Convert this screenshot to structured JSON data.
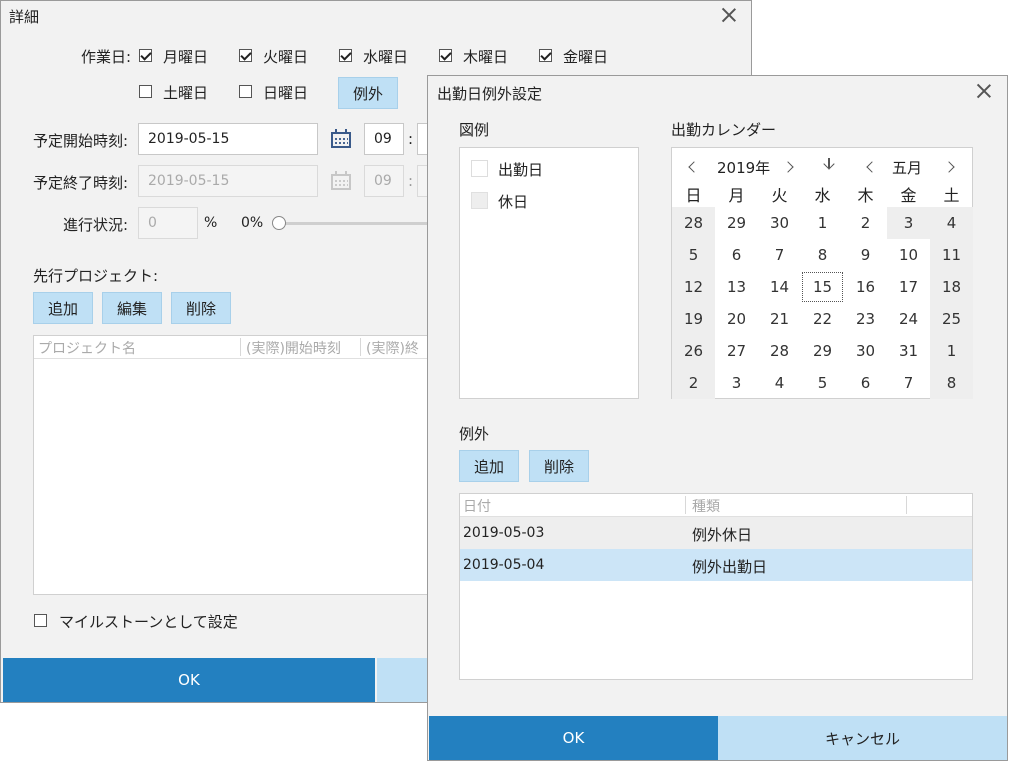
{
  "detail": {
    "title": "詳細",
    "workdays_label": "作業日:",
    "days": [
      {
        "label": "月曜日",
        "checked": true
      },
      {
        "label": "火曜日",
        "checked": true
      },
      {
        "label": "水曜日",
        "checked": true
      },
      {
        "label": "木曜日",
        "checked": true
      },
      {
        "label": "金曜日",
        "checked": true
      },
      {
        "label": "土曜日",
        "checked": false
      },
      {
        "label": "日曜日",
        "checked": false
      }
    ],
    "exception_button": "例外",
    "start_label": "予定開始時刻:",
    "start_date": "2019-05-15",
    "start_hour": "09",
    "end_label": "予定終了時刻:",
    "end_date": "2019-05-15",
    "end_hour": "09",
    "progress_label": "進行状況:",
    "progress_value": "0",
    "progress_unit": "%",
    "progress_pct_text": "0%",
    "progress_fraction": 0,
    "predecessor_label": "先行プロジェクト:",
    "add": "追加",
    "edit": "編集",
    "delete": "削除",
    "columns": [
      "プロジェクト名",
      "(実際)開始時刻",
      "(実際)終"
    ],
    "milestone_label": "マイルストーンとして設定",
    "ok": "OK",
    "colon": ":"
  },
  "exception_dialog": {
    "title": "出勤日例外設定",
    "legend_title": "図例",
    "legend": [
      {
        "label": "出勤日",
        "color": "#ffffff"
      },
      {
        "label": "休日",
        "color": "#eeeeee"
      }
    ],
    "calendar_title": "出勤カレンダー",
    "year": "2019年",
    "month": "五月",
    "dow": [
      "日",
      "月",
      "火",
      "水",
      "木",
      "金",
      "土"
    ],
    "weeks": [
      [
        "28",
        "29",
        "30",
        "1",
        "2",
        "3",
        "4"
      ],
      [
        "5",
        "6",
        "7",
        "8",
        "9",
        "10",
        "11"
      ],
      [
        "12",
        "13",
        "14",
        "15",
        "16",
        "17",
        "18"
      ],
      [
        "19",
        "20",
        "21",
        "22",
        "23",
        "24",
        "25"
      ],
      [
        "26",
        "27",
        "28",
        "29",
        "30",
        "31",
        "1"
      ],
      [
        "2",
        "3",
        "4",
        "5",
        "6",
        "7",
        "8"
      ]
    ],
    "exceptions_title": "例外",
    "add": "追加",
    "delete": "削除",
    "columns": [
      "日付",
      "種類"
    ],
    "rows": [
      {
        "date": "2019-05-03",
        "type": "例外休日"
      },
      {
        "date": "2019-05-04",
        "type": "例外出勤日"
      }
    ],
    "ok": "OK",
    "cancel": "キャンセル"
  },
  "colors": {
    "accent": "#2380c0",
    "button_light": "#bfe0f5",
    "selected_row": "#cce5f7",
    "holiday": "#eeeeee"
  }
}
